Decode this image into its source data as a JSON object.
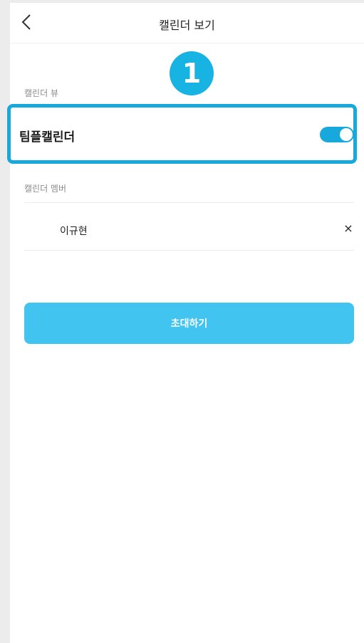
{
  "header": {
    "title": "캘린더 보기",
    "back_icon": "chevron-left-icon"
  },
  "badge": {
    "number": "1"
  },
  "calendar_view": {
    "section_label": "캘린더 뷰",
    "item_label": "팀플캘린더",
    "toggle_on": true,
    "toggle_color": "#17a8dc"
  },
  "members": {
    "section_label": "캘린더 멤버",
    "items": [
      {
        "name": "이규현",
        "remove_label": "×"
      }
    ]
  },
  "invite_button": {
    "label": "초대하기",
    "color": "#41c4ef"
  },
  "highlight_color": "#17a8dc"
}
